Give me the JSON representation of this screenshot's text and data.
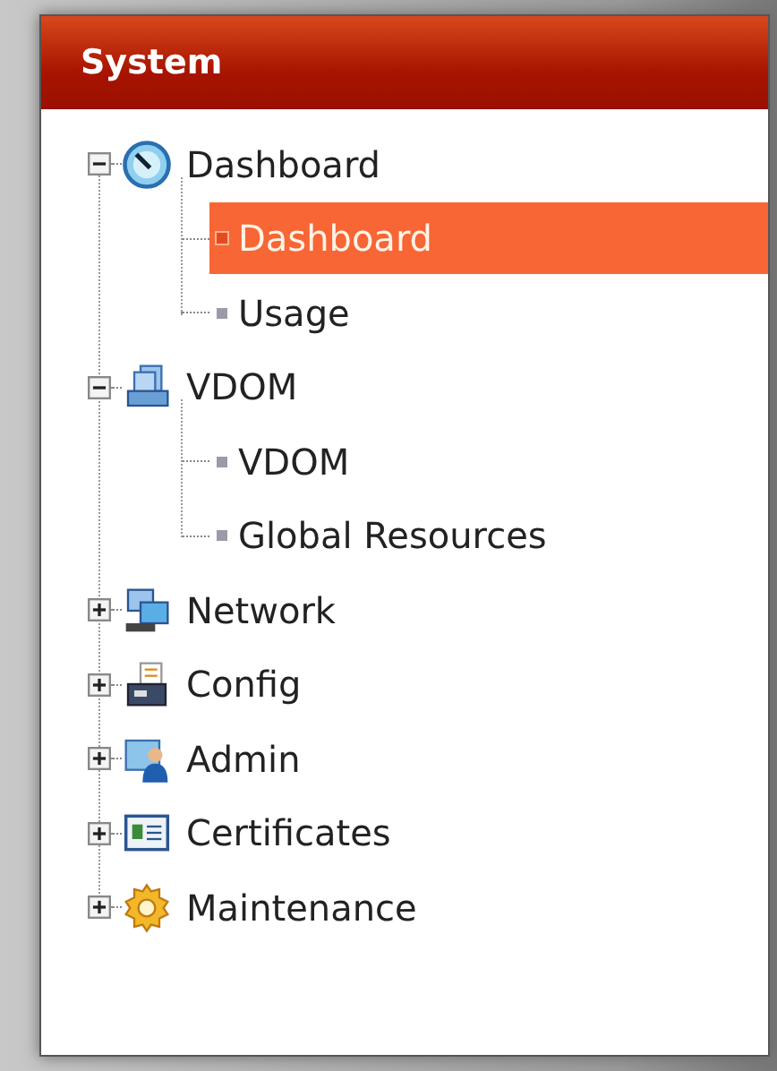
{
  "panel": {
    "title": "System"
  },
  "tree": [
    {
      "label": "Dashboard",
      "expanded": true,
      "children": [
        {
          "label": "Dashboard",
          "selected": true
        },
        {
          "label": "Usage",
          "selected": false
        }
      ]
    },
    {
      "label": "VDOM",
      "expanded": true,
      "children": [
        {
          "label": "VDOM",
          "selected": false
        },
        {
          "label": "Global Resources",
          "selected": false
        }
      ]
    },
    {
      "label": "Network",
      "expanded": false
    },
    {
      "label": "Config",
      "expanded": false
    },
    {
      "label": "Admin",
      "expanded": false
    },
    {
      "label": "Certificates",
      "expanded": false
    },
    {
      "label": "Maintenance",
      "expanded": false
    }
  ]
}
